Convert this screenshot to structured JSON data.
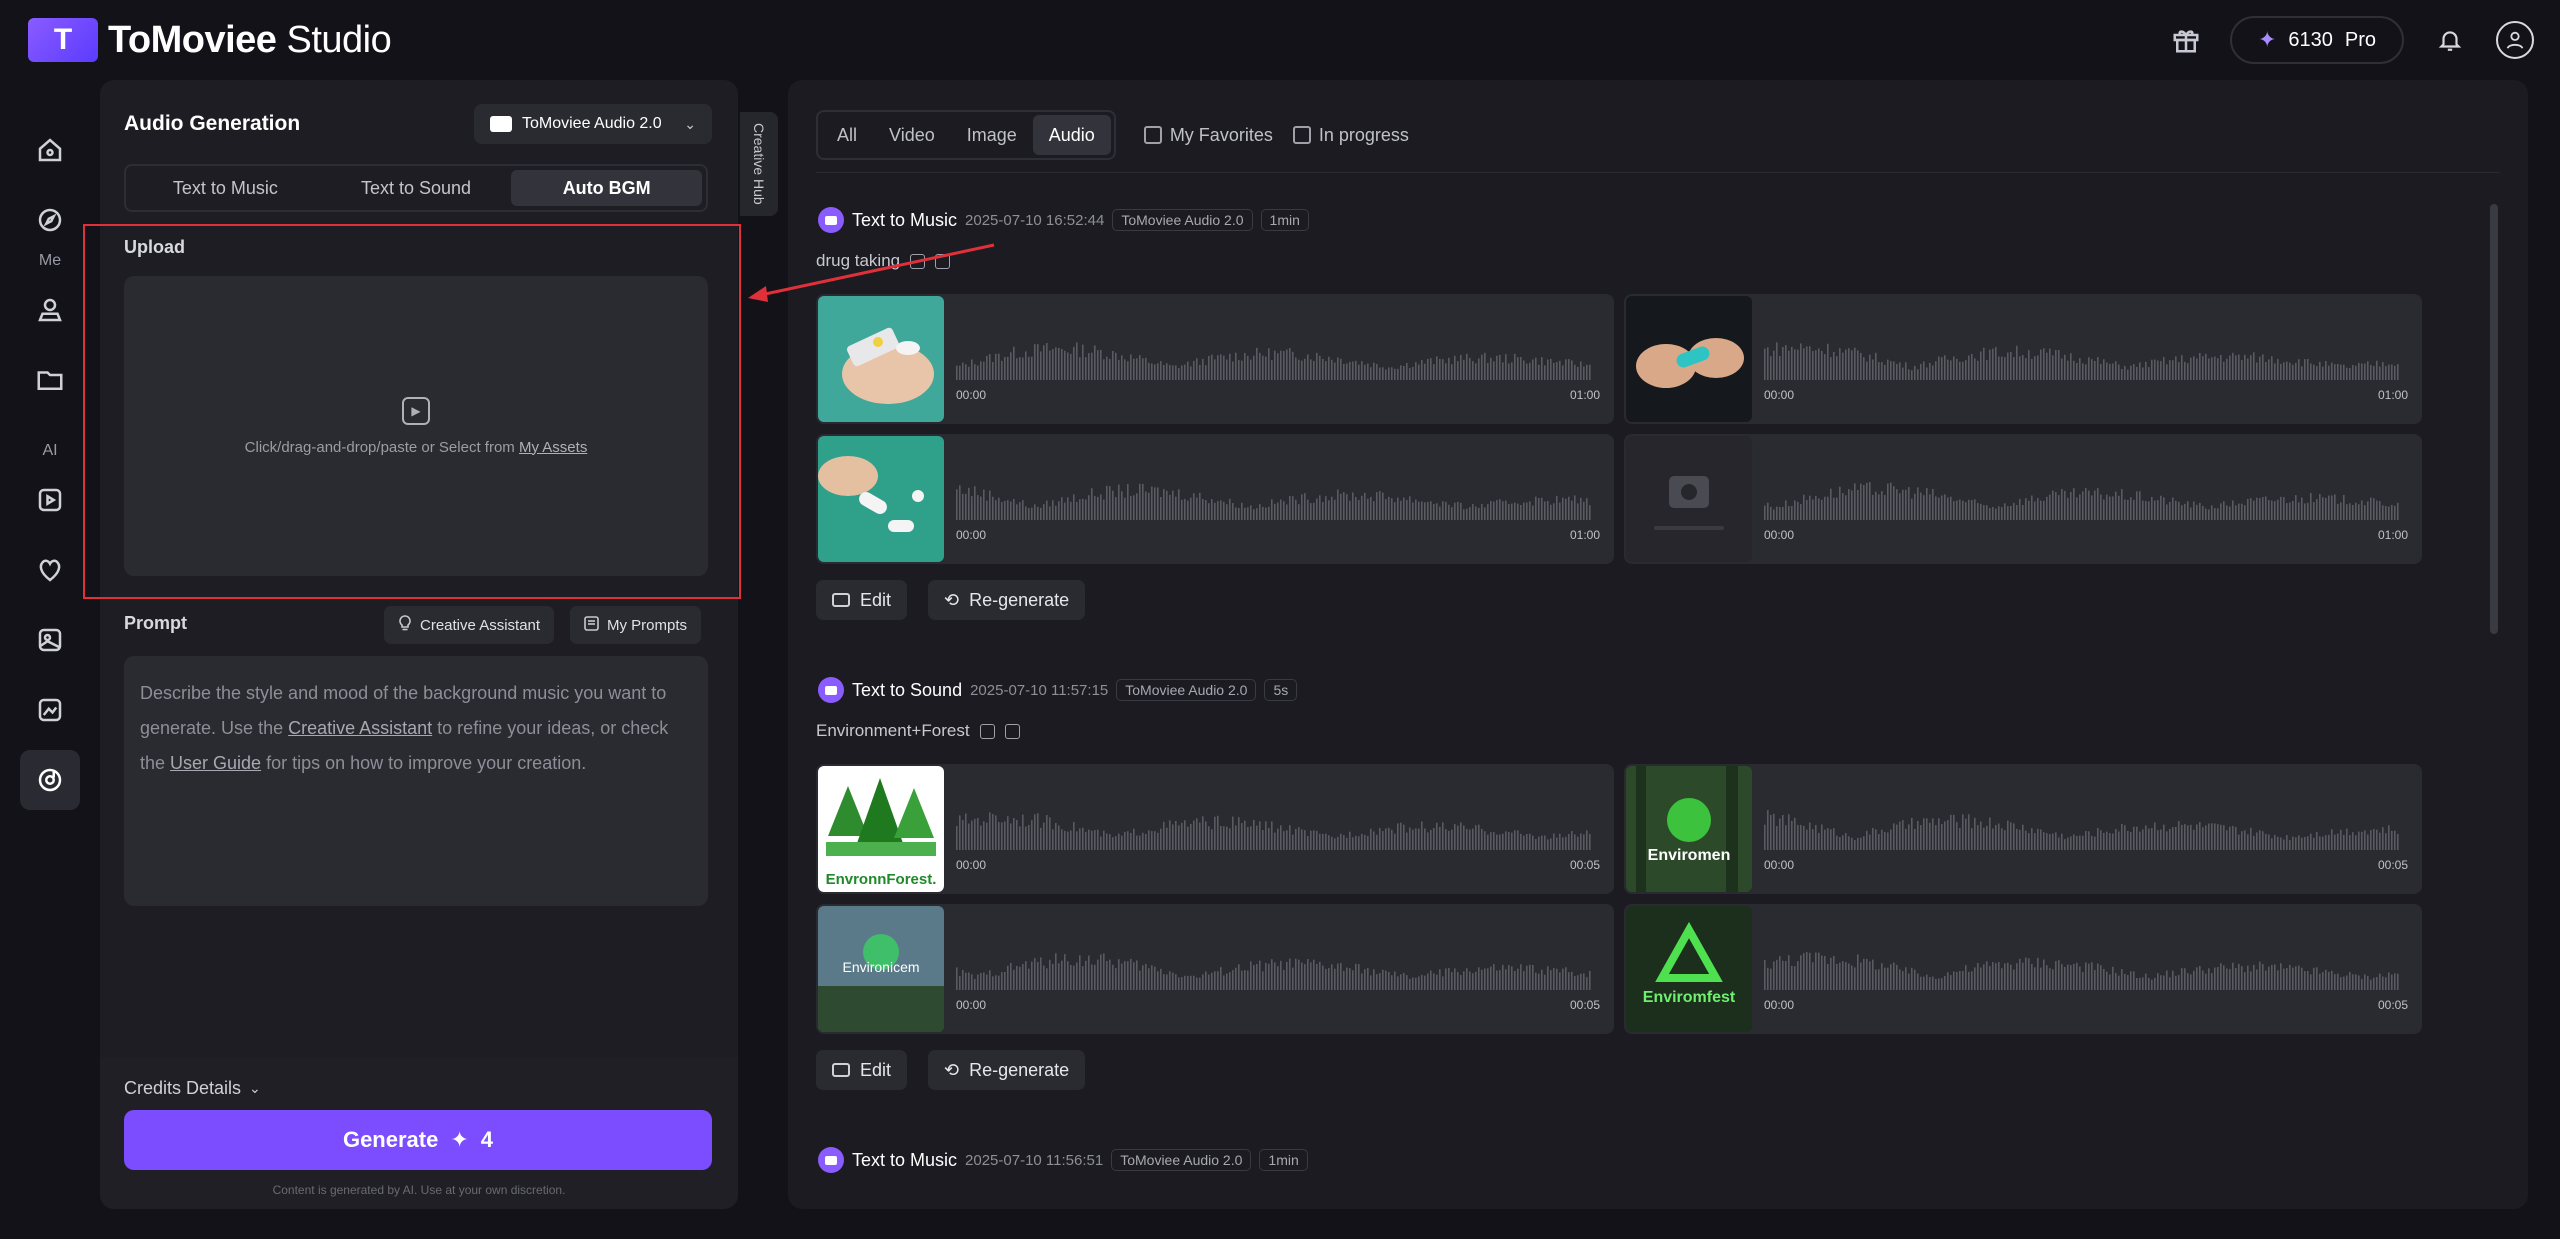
{
  "app": {
    "brand_bold": "ToMoviee",
    "brand_light": " Studio",
    "credits": "6130",
    "plan": "Pro"
  },
  "nav": {
    "section_me": "Me",
    "section_ai": "AI"
  },
  "panel": {
    "title": "Audio Generation",
    "model": "ToMoviee Audio 2.0",
    "tabs": [
      "Text to Music",
      "Text to Sound",
      "Auto BGM"
    ],
    "upload_label": "Upload",
    "upload_text": "Click/drag-and-drop/paste or Select from ",
    "upload_link": "My Assets",
    "prompt_label": "Prompt",
    "creative_assistant": "Creative Assistant",
    "my_prompts": "My Prompts",
    "placeholder_1": "Describe the style and mood of the background music you want to generate. Use the ",
    "placeholder_link1": "Creative Assistant",
    "placeholder_2": " to refine your ideas, or check the ",
    "placeholder_link2": "User Guide",
    "placeholder_3": " for tips on how to improve your creation.",
    "credits_details": "Credits Details",
    "generate": "Generate",
    "generate_cost": "4",
    "disclaimer": "Content is generated by AI. Use at your own discretion.",
    "creative_hub": "Creative Hub"
  },
  "filters": {
    "tabs": [
      "All",
      "Video",
      "Image",
      "Audio"
    ],
    "favorites": "My Favorites",
    "in_progress": "In progress"
  },
  "entries": [
    {
      "type": "Text to Music",
      "time": "2025-07-10 16:52:44",
      "model": "ToMoviee Audio 2.0",
      "duration": "1min",
      "prompt": "drug taking",
      "start": "00:00",
      "end": "01:00"
    },
    {
      "type": "Text to Sound",
      "time": "2025-07-10 11:57:15",
      "model": "ToMoviee Audio 2.0",
      "duration": "5s",
      "prompt": "Environment+Forest",
      "start": "00:00",
      "end": "00:05",
      "thumb_texts": [
        "EnvronnForest.",
        "Enviromen",
        "Environicem",
        "Enviromfest"
      ]
    },
    {
      "type": "Text to Music",
      "time": "2025-07-10 11:56:51",
      "model": "ToMoviee Audio 2.0",
      "duration": "1min"
    }
  ],
  "actions": {
    "edit": "Edit",
    "regenerate": "Re-generate"
  }
}
